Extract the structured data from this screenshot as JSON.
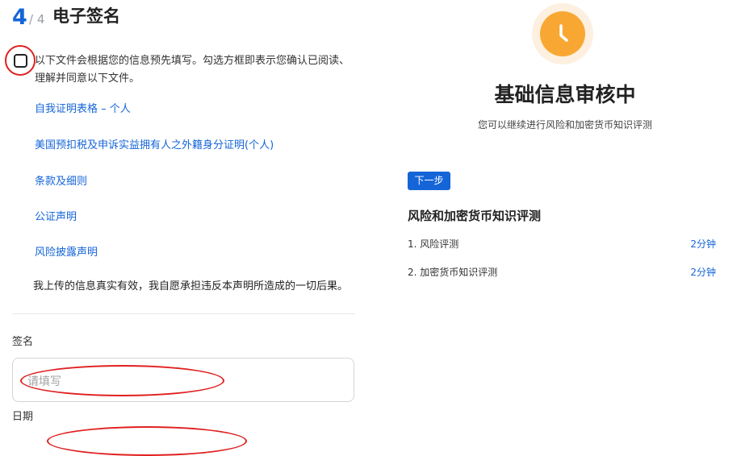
{
  "step": {
    "current": "4",
    "total": "/ 4",
    "title": "电子签名"
  },
  "consent": {
    "text": "以下文件会根据您的信息预先填写。勾选方框即表示您确认已阅读、理解并同意以下文件。",
    "checked": false
  },
  "documents": [
    "自我证明表格 – 个人",
    "美国预扣税及申诉实益拥有人之外籍身分证明(个人)",
    "条款及细则",
    "公证声明",
    "风险披露声明"
  ],
  "declaration": "我上传的信息真实有效，我自愿承担违反本声明所造成的一切后果。",
  "signature": {
    "label": "签名",
    "placeholder": "请填写"
  },
  "date": {
    "label": "日期"
  },
  "review": {
    "title": "基础信息审核中",
    "subtitle": "您可以继续进行风险和加密货币知识评测",
    "next_button": "下一步"
  },
  "assessment": {
    "title": "风险和加密货币知识评测",
    "items": [
      {
        "label": "1. 风险评测",
        "time": "2分钟"
      },
      {
        "label": "2. 加密货币知识评测",
        "time": "2分钟"
      }
    ]
  },
  "colors": {
    "accent": "#1565d8",
    "clock": "#f8a832",
    "annotation": "#e02020"
  }
}
